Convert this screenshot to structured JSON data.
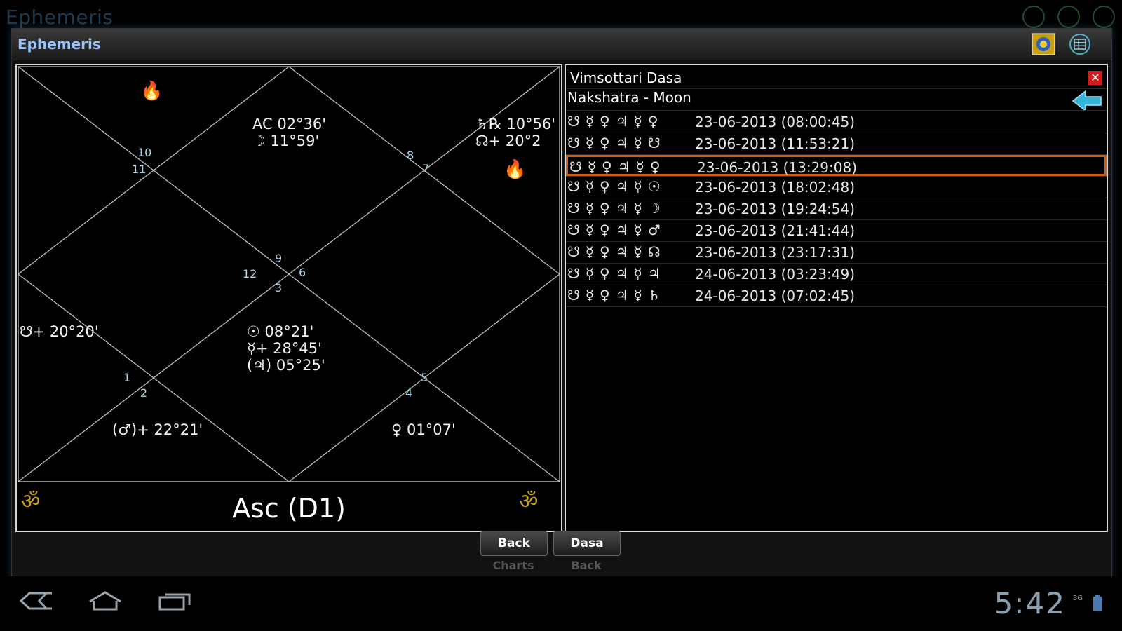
{
  "background": {
    "title": "Ephemeris",
    "icons": [
      "settings-icon",
      "add-icon",
      "clock-icon"
    ]
  },
  "window": {
    "title": "Ephemeris"
  },
  "chart": {
    "label": "Asc (D1)",
    "house_numbers": [
      "10",
      "11",
      "8",
      "7",
      "9",
      "12",
      "6",
      "3",
      "1",
      "2",
      "5",
      "4"
    ],
    "cells": {
      "top_center": "AC 02°36'\n☽ 11°59'",
      "top_right": "♄℞ 10°56'\n☊+ 20°2",
      "left": "☋+ 20°20'",
      "center_bottom": "☉ 08°21'\n☿+ 28°45'\n(♃) 05°25'",
      "bottom_left": "(♂)+ 22°21'",
      "bottom_right": "♀ 01°07'"
    },
    "om_symbol": "ॐ",
    "fire_symbol": "🔥"
  },
  "dasa": {
    "title": "Vimsottari Dasa",
    "nakshatra": "Nakshatra - Moon",
    "close_label": "✕",
    "selected_index": 2,
    "rows": [
      {
        "symbols": "☋☿♀♃☿♀",
        "date": "23-06-2013 (08:00:45)"
      },
      {
        "symbols": "☋☿♀♃☿☋",
        "date": "23-06-2013 (11:53:21)"
      },
      {
        "symbols": "☋☿♀♃☿♀",
        "date": "23-06-2013 (13:29:08)"
      },
      {
        "symbols": "☋☿♀♃☿☉",
        "date": "23-06-2013 (18:02:48)"
      },
      {
        "symbols": "☋☿♀♃☿☽",
        "date": "23-06-2013 (19:24:54)"
      },
      {
        "symbols": "☋☿♀♃☿♂",
        "date": "23-06-2013 (21:41:44)"
      },
      {
        "symbols": "☋☿♀♃☿☊",
        "date": "23-06-2013 (23:17:31)"
      },
      {
        "symbols": "☋☿♀♃☿♃",
        "date": "24-06-2013 (03:23:49)"
      },
      {
        "symbols": "☋☿♀♃☿♄",
        "date": "24-06-2013 (07:02:45)"
      }
    ]
  },
  "buttons": {
    "back": "Back",
    "dasa": "Dasa",
    "back_sub": "Charts",
    "dasa_sub": "Back"
  },
  "status": {
    "time": "5:42",
    "network": "3G"
  },
  "colors": {
    "selection": "#d06010",
    "accent_title": "#9bc4ff",
    "close": "#d41c1c",
    "arrow": "#36b4d8"
  }
}
